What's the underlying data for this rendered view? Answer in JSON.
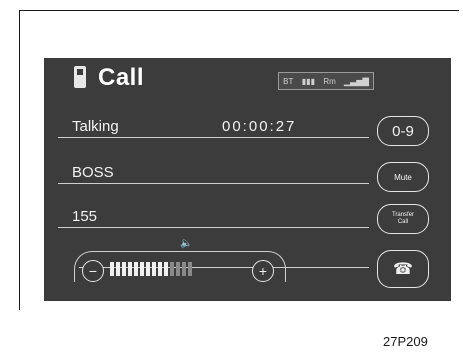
{
  "title": "Call",
  "status": {
    "bt": "BT",
    "roam": "Rm"
  },
  "rows": {
    "status_text": "Talking",
    "timer": "00:00:27",
    "contact": "BOSS",
    "number": "155"
  },
  "buttons": {
    "keypad": "0-9",
    "mute": "Mute",
    "transfer_line1": "Transfer",
    "transfer_line2": "Call",
    "end_icon": "☎"
  },
  "volume": {
    "icon": "🔈",
    "minus": "−",
    "plus": "+",
    "level": 0.7,
    "total_bars": 14,
    "active_bars": 10
  },
  "caption": "27P209"
}
